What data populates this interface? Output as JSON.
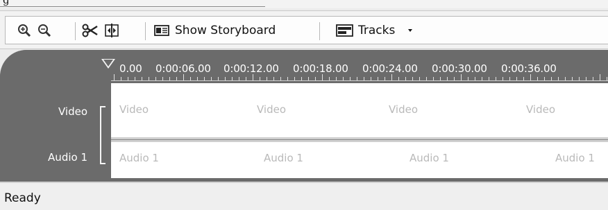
{
  "menu": {
    "fragment": "g"
  },
  "toolbar": {
    "buttons": [
      {
        "icon": "zoom-in-icon"
      },
      {
        "icon": "zoom-out-icon"
      },
      {
        "icon": "split-clip-icon"
      },
      {
        "icon": "split-frames-icon"
      }
    ],
    "storyboard_label": "Show Storyboard",
    "tracks_label": "Tracks"
  },
  "timeline": {
    "ruler_labels": [
      "0.00",
      "0:00:06.00",
      "0:00:12.00",
      "0:00:18.00",
      "0:00:24.00",
      "0:00:30.00",
      "0:00:36.00"
    ],
    "tracks": [
      {
        "name": "Video",
        "clip_labels": [
          "Video",
          "Video",
          "Video",
          "Video"
        ]
      },
      {
        "name": "Audio 1",
        "clip_labels": [
          "Audio 1",
          "Audio 1",
          "Audio 1",
          "Audio 1"
        ]
      }
    ]
  },
  "status": {
    "text": "Ready"
  }
}
